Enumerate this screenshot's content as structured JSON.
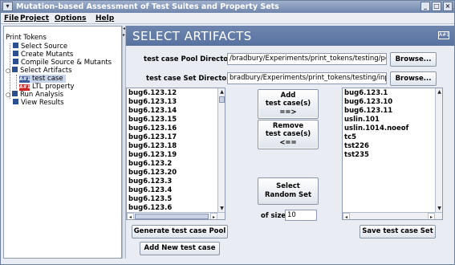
{
  "window": {
    "title": "Mutation-based Assessment of Test Suites and Property Sets",
    "controls": [
      "_",
      "□",
      "×"
    ]
  },
  "menu": {
    "items": [
      {
        "label": "File"
      },
      {
        "label": "Project"
      },
      {
        "label": "Options"
      },
      {
        "label": "Help"
      }
    ]
  },
  "tree": {
    "root": "Print Tokens",
    "items": [
      {
        "label": "Select Source"
      },
      {
        "label": "Create Mutants"
      },
      {
        "label": "Compile Source & Mutants"
      },
      {
        "label": "Select Artifacts"
      },
      {
        "label": "test case",
        "badge": "A#1"
      },
      {
        "label": "LTL property",
        "badge": "A#1"
      },
      {
        "label": "Run Analysis"
      },
      {
        "label": "View Results"
      }
    ]
  },
  "panel": {
    "title": "SELECT ARTIFACTS",
    "badge": "A#1",
    "pool_dir_label": "test case Pool Directory:",
    "pool_dir_value": "/bradbury/Experiments/print_tokens/testing/pool/",
    "set_dir_label": "test case Set Directory:",
    "set_dir_value": "bradbury/Experiments/print_tokens/testing/input/",
    "browse_label": "Browse...",
    "add_label_1": "Add",
    "add_label_2": "test case(s)",
    "add_label_3": "==>",
    "remove_label_1": "Remove",
    "remove_label_2": "test case(s)",
    "remove_label_3": "<==",
    "select_random_1": "Select",
    "select_random_2": "Random Set",
    "of_size_label": "of size:",
    "of_size_value": "10",
    "generate_pool_label": "Generate test case Pool",
    "add_new_label": "Add New test case",
    "save_set_label": "Save test case Set"
  },
  "pool_list": {
    "items": [
      "bug6.123.12",
      "bug6.123.13",
      "bug6.123.14",
      "bug6.123.15",
      "bug6.123.16",
      "bug6.123.17",
      "bug6.123.18",
      "bug6.123.19",
      "bug6.123.2",
      "bug6.123.20",
      "bug6.123.3",
      "bug6.123.4",
      "bug6.123.5",
      "bug6.123.6"
    ]
  },
  "set_list": {
    "items": [
      "bug6.123.1",
      "bug6.123.10",
      "bug6.123.11",
      "uslin.101",
      "uslin.1014.noeof",
      "tc5",
      "tst226",
      "tst235"
    ]
  },
  "colors": {
    "header_bg": "#6e86ae",
    "badge_red": "#cc2222",
    "badge_blue": "#3a5a9a",
    "tree_square": "#2c4f8f"
  }
}
